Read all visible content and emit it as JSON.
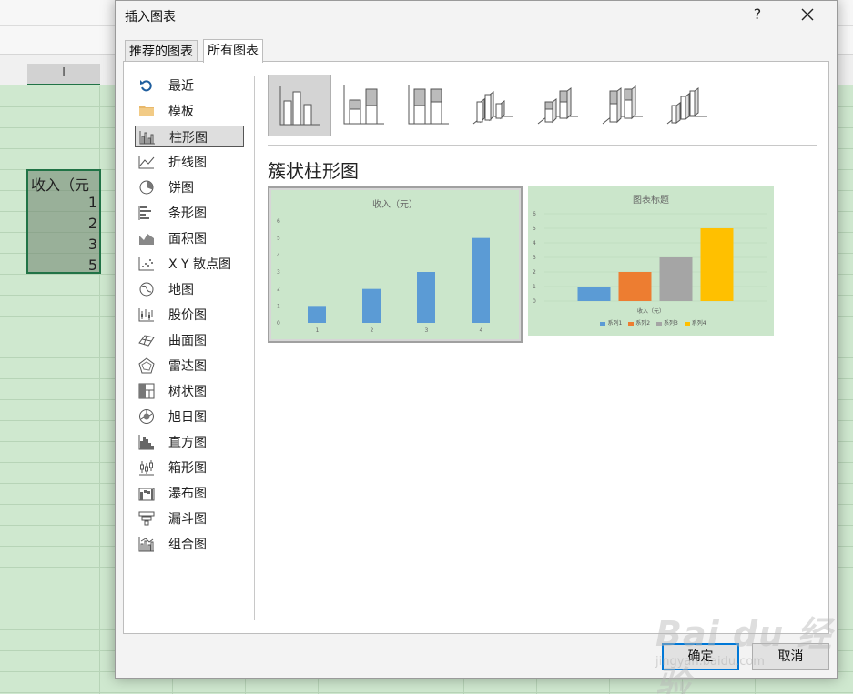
{
  "sheet": {
    "column_header": "I",
    "cell_header": "收入（元",
    "values": [
      "1",
      "2",
      "3",
      "5"
    ]
  },
  "dialog": {
    "title": "插入图表",
    "help_label": "?",
    "tabs": [
      "推荐的图表",
      "所有图表"
    ],
    "chart_types": [
      {
        "label": "最近",
        "icon": "recent-icon"
      },
      {
        "label": "模板",
        "icon": "folder-icon"
      },
      {
        "label": "柱形图",
        "icon": "column-chart-icon"
      },
      {
        "label": "折线图",
        "icon": "line-chart-icon"
      },
      {
        "label": "饼图",
        "icon": "pie-chart-icon"
      },
      {
        "label": "条形图",
        "icon": "bar-chart-icon"
      },
      {
        "label": "面积图",
        "icon": "area-chart-icon"
      },
      {
        "label": "X Y 散点图",
        "icon": "scatter-chart-icon"
      },
      {
        "label": "地图",
        "icon": "map-chart-icon"
      },
      {
        "label": "股价图",
        "icon": "stock-chart-icon"
      },
      {
        "label": "曲面图",
        "icon": "surface-chart-icon"
      },
      {
        "label": "雷达图",
        "icon": "radar-chart-icon"
      },
      {
        "label": "树状图",
        "icon": "treemap-chart-icon"
      },
      {
        "label": "旭日图",
        "icon": "sunburst-chart-icon"
      },
      {
        "label": "直方图",
        "icon": "histogram-chart-icon"
      },
      {
        "label": "箱形图",
        "icon": "box-whisker-chart-icon"
      },
      {
        "label": "瀑布图",
        "icon": "waterfall-chart-icon"
      },
      {
        "label": "漏斗图",
        "icon": "funnel-chart-icon"
      },
      {
        "label": "组合图",
        "icon": "combo-chart-icon"
      }
    ],
    "selected_type": "柱形图",
    "variant_title": "簇状柱形图",
    "ok_label": "确定",
    "cancel_label": "取消",
    "colors": {
      "accent": "#0078d7",
      "series1": "#5b9bd5",
      "series2": "#ed7d31",
      "series3": "#a5a5a5",
      "series4": "#ffc000",
      "preview_bg": "#cbe6cb"
    }
  },
  "chart_data": [
    {
      "type": "bar",
      "title": "收入（元）",
      "categories": [
        "1",
        "2",
        "3",
        "4"
      ],
      "values": [
        1,
        2,
        3,
        5
      ],
      "ylim": [
        0,
        6
      ],
      "yticks": [
        0,
        1,
        2,
        3,
        4,
        5,
        6
      ],
      "grid": false
    },
    {
      "type": "bar",
      "title": "图表标题",
      "xlabel": "收入（元）",
      "categories": [
        "收入（元）"
      ],
      "series": [
        {
          "name": "系列1",
          "values": [
            1
          ]
        },
        {
          "name": "系列2",
          "values": [
            2
          ]
        },
        {
          "name": "系列3",
          "values": [
            3
          ]
        },
        {
          "name": "系列4",
          "values": [
            5
          ]
        }
      ],
      "ylim": [
        0,
        6
      ],
      "yticks": [
        0,
        1,
        2,
        3,
        4,
        5,
        6
      ],
      "legend": "bottom",
      "grid": true
    }
  ],
  "watermark": {
    "logo": "Bai du 经验",
    "text": "jingyan.baidu.com"
  }
}
